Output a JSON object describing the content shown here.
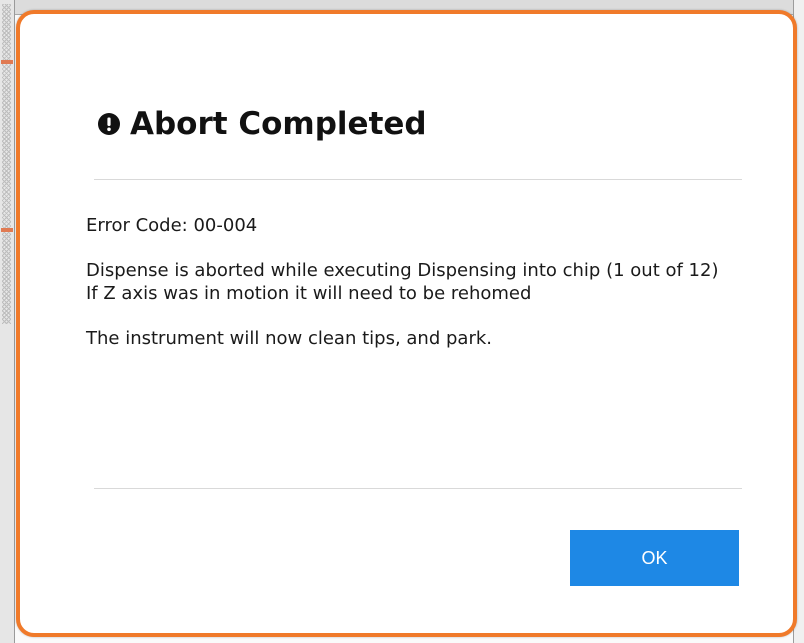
{
  "dialog": {
    "title": "Abort Completed",
    "icon": "exclamation-circle-icon",
    "error_code": "Error Code: 00-004",
    "message_line1": "Dispense is aborted while executing Dispensing into chip (1 out of 12)",
    "message_line2": "If Z axis was in motion it will need to be rehomed",
    "message_line3": "The instrument will now clean tips, and park.",
    "ok_label": "OK"
  },
  "colors": {
    "dialog_border": "#f07a2a",
    "ok_button": "#1e88e5"
  }
}
